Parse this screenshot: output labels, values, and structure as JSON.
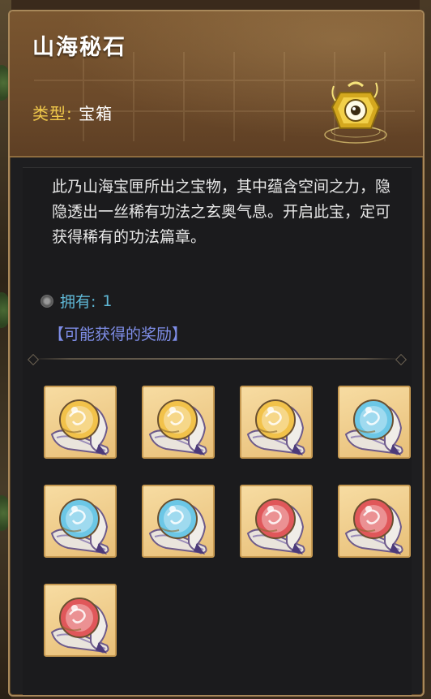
{
  "item": {
    "title": "山海秘石",
    "type_label": "类型:",
    "type_value": "宝箱",
    "icon": "golden-chest-orb-icon",
    "description": "此乃山海宝匣所出之宝物，其中蕴含空间之力，隐隐透出一丝稀有功法之玄奥气息。开启此宝，定可获得稀有的功法篇章。",
    "owned_label": "拥有:",
    "owned_value": "1",
    "rewards_title": "【可能获得的奖励】"
  },
  "rewards": [
    {
      "icon": "golden-scroll-orb-icon",
      "orb_color": "#f2c24a"
    },
    {
      "icon": "golden-scroll-orb-icon",
      "orb_color": "#f2c24a"
    },
    {
      "icon": "golden-scroll-orb-icon",
      "orb_color": "#f2c24a"
    },
    {
      "icon": "blue-scroll-orb-icon",
      "orb_color": "#6cc7e6"
    },
    {
      "icon": "blue-scroll-orb-icon",
      "orb_color": "#6cc7e6"
    },
    {
      "icon": "blue-scroll-orb-icon",
      "orb_color": "#6cc7e6"
    },
    {
      "icon": "red-scroll-orb-icon",
      "orb_color": "#e0575a"
    },
    {
      "icon": "red-scroll-orb-icon",
      "orb_color": "#e0575a"
    },
    {
      "icon": "red-scroll-orb-icon",
      "orb_color": "#e0575a"
    }
  ],
  "colors": {
    "title": "#ffffff",
    "type_label": "#f0c84a",
    "owned": "#5fb8d6",
    "rewards_title": "#7f8ee8",
    "tile_bg": "#efcf8e"
  }
}
